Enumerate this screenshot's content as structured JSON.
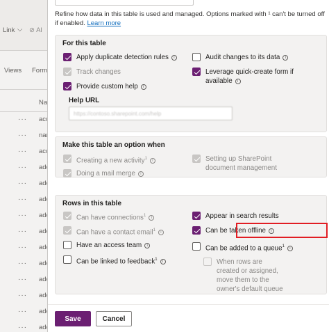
{
  "background": {
    "nav_link": "Link",
    "nav_chevron": "⌵",
    "nav_extra": "Al",
    "tab_views": "Views",
    "tab_forms": "Form",
    "col_header": "Na",
    "rows": [
      "acc",
      "nan",
      "acc",
      "adc",
      "adc",
      "adc",
      "adc",
      "adc",
      "adc",
      "adc",
      "adc",
      "adc",
      "adc",
      "adc"
    ]
  },
  "panel": {
    "intro_text": "Refine how data in this table is used and managed. Options marked with ¹ can't be turned off if enabled.",
    "learn_more": "Learn more"
  },
  "for_this_table": {
    "title": "For this table",
    "options": [
      {
        "label": "Apply duplicate detection rules",
        "checked": true,
        "disabled": false
      },
      {
        "label": "Track changes",
        "checked": true,
        "disabled": true
      },
      {
        "label": "Provide custom help",
        "checked": true,
        "disabled": false
      },
      {
        "label": "Audit changes to its data",
        "checked": false,
        "disabled": false
      },
      {
        "label": "Leverage quick-create form if available",
        "checked": true,
        "disabled": false
      }
    ],
    "help_url_label": "Help URL",
    "help_url_value": "https://contoso.sharepoint.com/help"
  },
  "option_when": {
    "title": "Make this table an option when",
    "options": [
      {
        "label": "Creating a new activity",
        "checked": true,
        "disabled": true
      },
      {
        "label": "Doing a mail merge",
        "checked": true,
        "disabled": true
      },
      {
        "label": "Setting up SharePoint document management",
        "checked": true,
        "disabled": true
      }
    ]
  },
  "rows_in_table": {
    "title": "Rows in this table",
    "options": [
      {
        "label": "Can have connections",
        "checked": true,
        "disabled": true
      },
      {
        "label": "Can have a contact email",
        "checked": true,
        "disabled": true
      },
      {
        "label": "Have an access team",
        "checked": false,
        "disabled": false
      },
      {
        "label": "Can be linked to feedback",
        "checked": false,
        "disabled": false
      },
      {
        "label": "Appear in search results",
        "checked": true,
        "disabled": false
      },
      {
        "label": "Can be taken offline",
        "checked": true,
        "disabled": false
      },
      {
        "label": "Can be added to a queue",
        "checked": false,
        "disabled": false
      },
      {
        "label": "When rows are created or assigned, move them to the owner's default queue",
        "checked": false,
        "disabled": true
      }
    ]
  },
  "superscript": "1",
  "info_glyph": "i",
  "buttons": {
    "save": "Save",
    "cancel": "Cancel"
  },
  "colors": {
    "accent": "#6b1f72",
    "highlight": "#e11d23"
  }
}
